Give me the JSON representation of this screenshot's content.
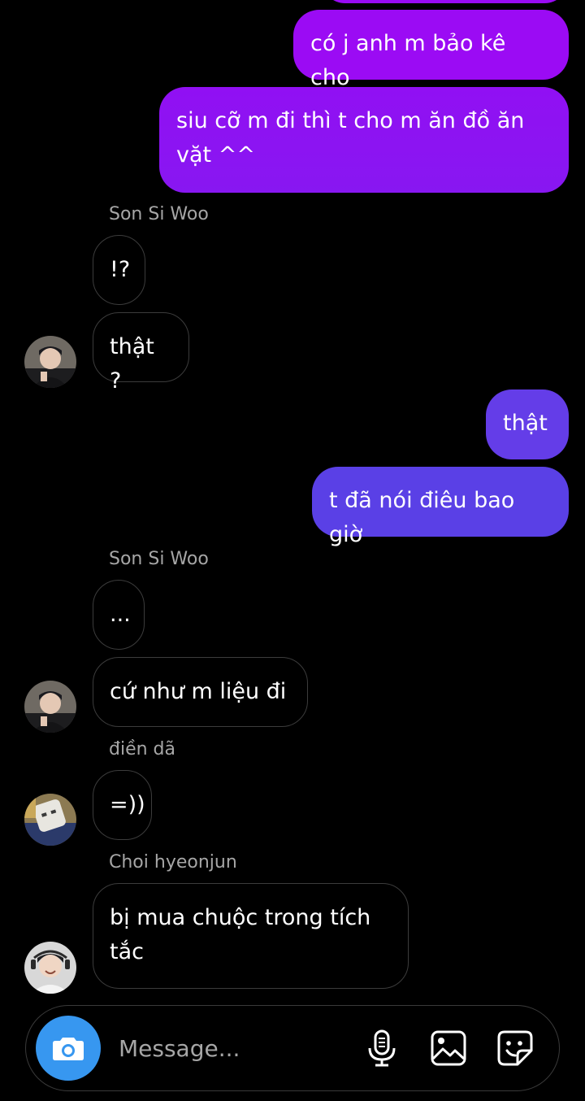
{
  "colors": {
    "background": "#000000",
    "outgoing_purple": "#9a0bf5",
    "outgoing_indigo": "#5a3fe6",
    "incoming_border": "#3c3c3c",
    "sender_name": "#a6a6a6",
    "camera_button": "#3797f0"
  },
  "messages": [
    {
      "direction": "outgoing",
      "text": "có j anh m bảo kê cho"
    },
    {
      "direction": "outgoing",
      "text": "siu cỡ m đi thì t cho m ăn đồ ăn\nvặt ^^"
    },
    {
      "direction": "incoming",
      "sender": "Son Si Woo",
      "text": "!?"
    },
    {
      "direction": "incoming",
      "text": "thật ?"
    },
    {
      "direction": "outgoing",
      "text": "thật"
    },
    {
      "direction": "outgoing",
      "text": "t đã nói điêu bao giờ"
    },
    {
      "direction": "incoming",
      "sender": "Son Si Woo",
      "text": "..."
    },
    {
      "direction": "incoming",
      "text": "cứ như m liệu đi"
    },
    {
      "direction": "incoming",
      "sender": "điền dã",
      "text": "=))"
    },
    {
      "direction": "incoming",
      "sender": "Choi hyeonjun",
      "text": "bị mua chuộc trong tích\ntắc"
    }
  ],
  "composer": {
    "placeholder": "Message...",
    "icons": [
      "camera-icon",
      "microphone-icon",
      "gallery-icon",
      "sticker-icon"
    ]
  }
}
